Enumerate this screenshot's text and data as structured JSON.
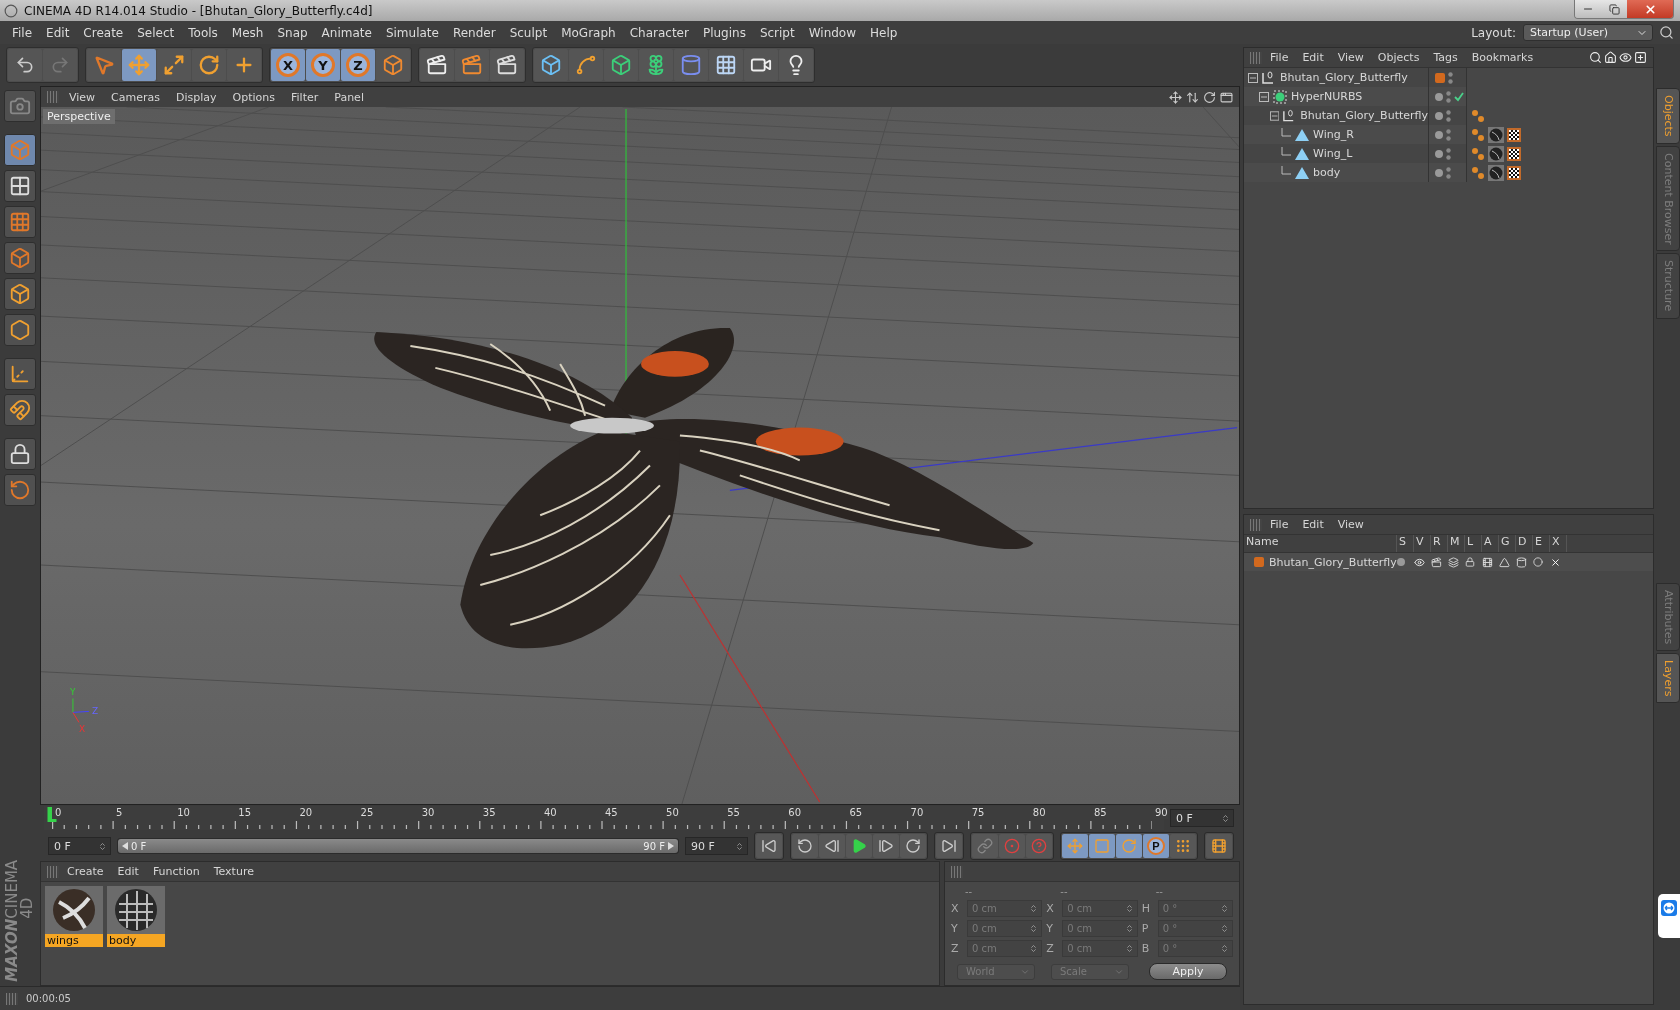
{
  "window": {
    "title": "CINEMA 4D R14.014 Studio - [Bhutan_Glory_Butterfly.c4d]"
  },
  "menu": [
    "File",
    "Edit",
    "Create",
    "Select",
    "Tools",
    "Mesh",
    "Snap",
    "Animate",
    "Simulate",
    "Render",
    "Sculpt",
    "MoGraph",
    "Character",
    "Plugins",
    "Script",
    "Window",
    "Help"
  ],
  "layout": {
    "label": "Layout:",
    "value": "Startup (User)"
  },
  "toolbar": {
    "tools": [
      {
        "kind": "select",
        "selected": false
      },
      {
        "kind": "move",
        "selected": true
      },
      {
        "kind": "scale",
        "selected": false
      },
      {
        "kind": "rotate",
        "selected": false
      },
      {
        "kind": "recent",
        "selected": false
      }
    ],
    "axes": [
      {
        "label": "X",
        "selected": true
      },
      {
        "label": "Y",
        "selected": true
      },
      {
        "label": "Z",
        "selected": true
      }
    ]
  },
  "left_tools": [
    {
      "kind": "camera",
      "selected": false
    },
    {
      "kind": "model",
      "selected": true
    },
    {
      "kind": "texture",
      "selected": false
    },
    {
      "kind": "workplane",
      "selected": false
    },
    {
      "kind": "points",
      "selected": false
    },
    {
      "kind": "edges",
      "selected": false
    },
    {
      "kind": "polygons",
      "selected": false
    },
    {
      "kind": "axis",
      "selected": false
    },
    {
      "kind": "snap",
      "selected": false
    },
    {
      "kind": "lock",
      "selected": false
    },
    {
      "kind": "grid",
      "selected": false
    }
  ],
  "viewport": {
    "menu": [
      "View",
      "Cameras",
      "Display",
      "Options",
      "Filter",
      "Panel"
    ],
    "camera": "Perspective",
    "gizmo_labels": [
      "Y",
      "Z",
      "X"
    ]
  },
  "timeline": {
    "ticks": [
      "0",
      "5",
      "10",
      "15",
      "20",
      "25",
      "30",
      "35",
      "40",
      "45",
      "50",
      "55",
      "60",
      "65",
      "70",
      "75",
      "80",
      "85",
      "90"
    ],
    "level": 0,
    "current_frame": "0 F"
  },
  "transport": {
    "start": "0 F",
    "range_start": "0 F",
    "range_end": "90 F",
    "level": 1,
    "end": "90 F",
    "key_buttons": [
      {
        "kind": "move",
        "selected": true
      },
      {
        "kind": "scale",
        "selected": true
      },
      {
        "kind": "rotate",
        "selected": true
      },
      {
        "kind": "param",
        "label": "P",
        "selected": true
      },
      {
        "kind": "points",
        "selected": false
      }
    ]
  },
  "logo": {
    "brand": "MAXON",
    "product": "CINEMA 4D"
  },
  "materials": {
    "menu": [
      "Create",
      "Edit",
      "Function",
      "Texture"
    ],
    "items": [
      {
        "name": "wings",
        "kind": "wings"
      },
      {
        "name": "body",
        "kind": "body"
      }
    ]
  },
  "coordinates": {
    "headers": [
      "--",
      "--",
      "--"
    ],
    "rows": [
      {
        "axis": "X",
        "position": "0 cm",
        "size_axis": "X",
        "size": "0 cm",
        "rotation_axis": "H",
        "rotation": "0 °"
      },
      {
        "axis": "Y",
        "position": "0 cm",
        "size_axis": "Y",
        "size": "0 cm",
        "rotation_axis": "P",
        "rotation": "0 °"
      },
      {
        "axis": "Z",
        "position": "0 cm",
        "size_axis": "Z",
        "size": "0 cm",
        "rotation_axis": "B",
        "rotation": "0 °"
      }
    ],
    "space": "World",
    "mode": "Scale",
    "apply": "Apply"
  },
  "status_bar": {
    "time": "00:00:05"
  },
  "objects": {
    "menu": [
      "File",
      "Edit",
      "View",
      "Objects",
      "Tags",
      "Bookmarks"
    ],
    "tree": [
      {
        "name": "Bhutan_Glory_Butterfly",
        "kind": "null",
        "layer": true,
        "checked": false,
        "children": [
          {
            "name": "HyperNURBS",
            "kind": "nurbs",
            "layer": false,
            "checked": true,
            "children": [
              {
                "name": "Bhutan_Glory_Butterfly",
                "kind": "null",
                "layer": false,
                "checked": false,
                "tags": [
                  {
                    "kind": "phong"
                  }
                ],
                "children": [
                  {
                    "name": "Wing_R",
                    "kind": "mesh",
                    "layer": false,
                    "checked": false,
                    "tags": [
                      {
                        "kind": "phong"
                      },
                      {
                        "kind": "material"
                      },
                      {
                        "kind": "checker"
                      }
                    ]
                  },
                  {
                    "name": "Wing_L",
                    "kind": "mesh",
                    "layer": false,
                    "checked": false,
                    "tags": [
                      {
                        "kind": "phong"
                      },
                      {
                        "kind": "material"
                      },
                      {
                        "kind": "checker"
                      }
                    ]
                  },
                  {
                    "name": "body",
                    "kind": "mesh",
                    "layer": false,
                    "checked": false,
                    "tags": [
                      {
                        "kind": "phong"
                      },
                      {
                        "kind": "material"
                      },
                      {
                        "kind": "checker"
                      }
                    ]
                  }
                ]
              }
            ]
          }
        ]
      }
    ]
  },
  "layers": {
    "menu": [
      "File",
      "Edit",
      "View"
    ],
    "columns": [
      "Name",
      "S",
      "V",
      "R",
      "M",
      "L",
      "A",
      "G",
      "D",
      "E",
      "X"
    ],
    "rows": [
      {
        "name": "Bhutan_Glory_Butterfly",
        "color": "#d2691e"
      }
    ]
  },
  "side_tabs": {
    "upper": [
      {
        "label": "Objects",
        "selected": true
      },
      {
        "label": "Content Browser",
        "selected": false
      },
      {
        "label": "Structure",
        "selected": false
      }
    ],
    "lower": [
      {
        "label": "Attributes",
        "selected": false
      },
      {
        "label": "Layers",
        "selected": true
      }
    ]
  }
}
